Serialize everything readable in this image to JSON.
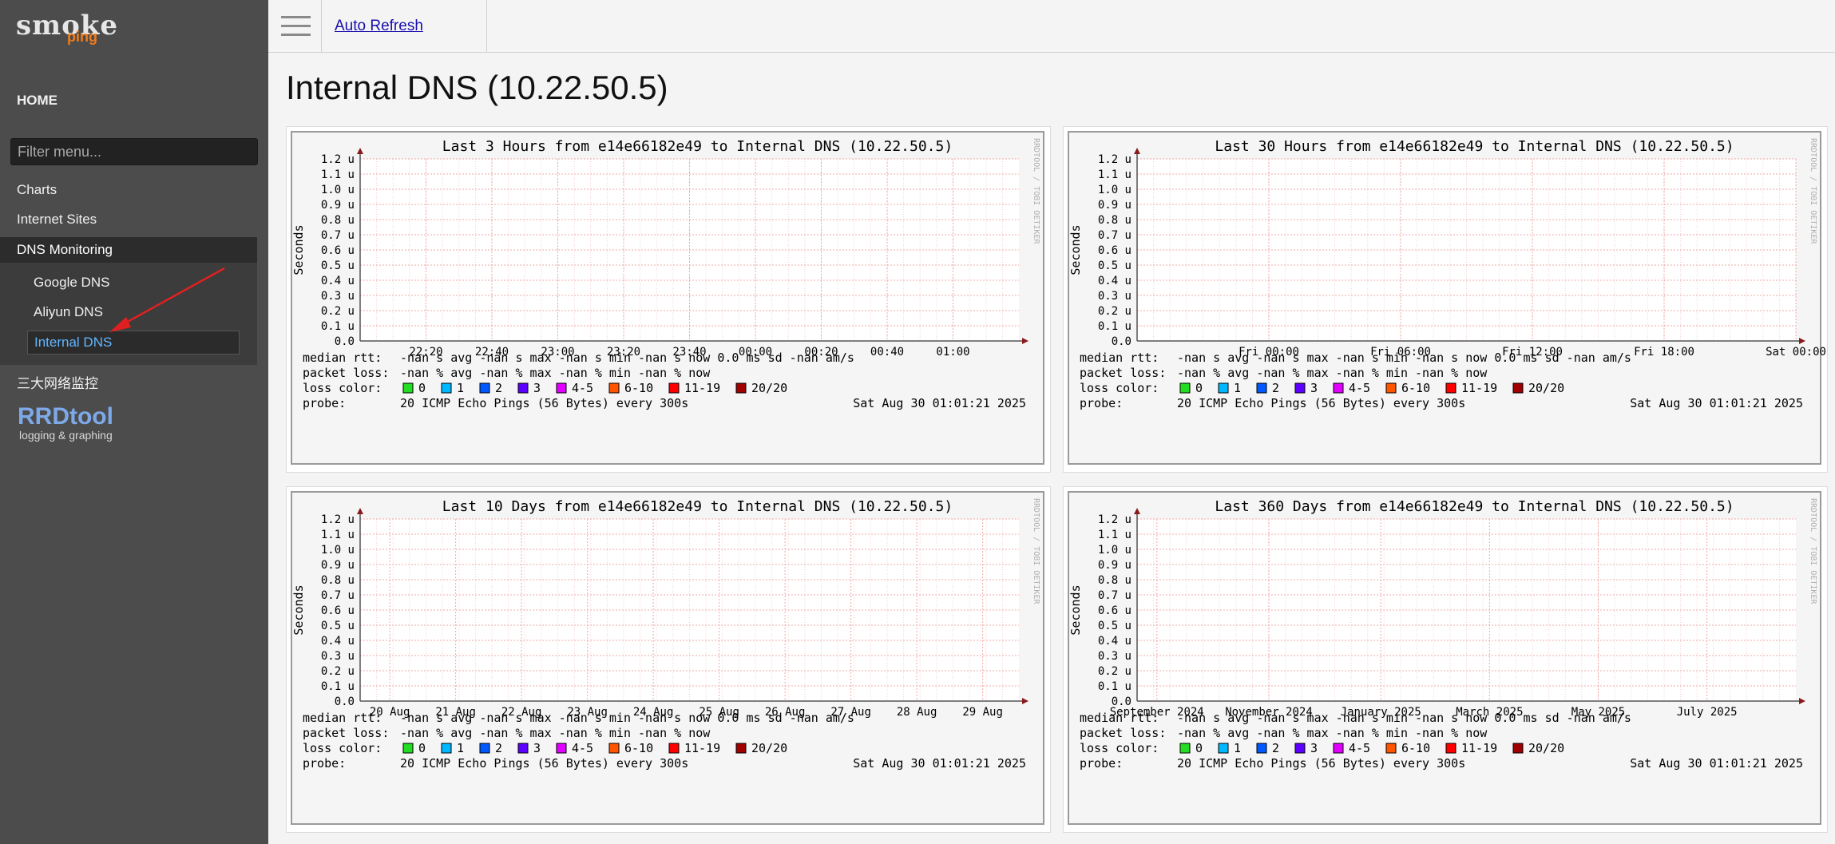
{
  "sidebar": {
    "logo_word": "smoke",
    "logo_sub": "ping",
    "home": "HOME",
    "filter_placeholder": "Filter menu...",
    "items": [
      "Charts",
      "Internet Sites"
    ],
    "dns_group": {
      "label": "DNS Monitoring",
      "children": [
        "Google DNS",
        "Aliyun DNS",
        "Internal DNS"
      ],
      "active": "Internal DNS"
    },
    "after_items": [
      "三大网络监控"
    ],
    "rrd_logo": "RRDtool",
    "rrd_tagline": "logging & graphing"
  },
  "topbar": {
    "auto_refresh": "Auto Refresh"
  },
  "main": {
    "title": "Internal DNS (10.22.50.5)"
  },
  "colors": {
    "sidebar_bg": "#4c4c4c",
    "active_link": "#62b6ff",
    "grid_minor": "#f7c7c7",
    "grid_major": "#e88",
    "annotation_arrow": "#e02020"
  },
  "chart_common": {
    "ylabel": "Seconds",
    "y_ticks": [
      "1.2 u",
      "1.1 u",
      "1.0 u",
      "0.9 u",
      "0.8 u",
      "0.7 u",
      "0.6 u",
      "0.5 u",
      "0.4 u",
      "0.3 u",
      "0.2 u",
      "0.1 u",
      "0.0"
    ],
    "watermark": "RRDTOOL / TOBI OETIKER",
    "median_rtt_label": "median rtt:",
    "median_rtt_value": "-nan  s avg   -nan  s max   -nan  s min   -nan  s now  0.0 ms sd   -nan   am/s",
    "packet_loss_label": "packet loss:",
    "packet_loss_value": "-nan % avg   -nan % max   -nan % min   -nan % now",
    "loss_color_label": "loss color:",
    "loss_colors": [
      {
        "label": "0",
        "color": "#22dd22"
      },
      {
        "label": "1",
        "color": "#00b8ff"
      },
      {
        "label": "2",
        "color": "#0059ff"
      },
      {
        "label": "3",
        "color": "#5e00ff"
      },
      {
        "label": "4-5",
        "color": "#e100ff"
      },
      {
        "label": "6-10",
        "color": "#ff5500"
      },
      {
        "label": "11-19",
        "color": "#ff0000"
      },
      {
        "label": "20/20",
        "color": "#a10000"
      }
    ],
    "probe_label": "probe:",
    "probe_value": "20 ICMP Echo Pings (56 Bytes) every 300s",
    "timestamp": "Sat Aug 30 01:01:21 2025"
  },
  "chart_data": [
    {
      "type": "line",
      "title": "Last 3 Hours from e14e66182e49 to Internal DNS (10.22.50.5)",
      "ylabel": "Seconds",
      "ylim": [
        0,
        1.2
      ],
      "y_unit": "u",
      "x_ticks": [
        "22:20",
        "22:40",
        "23:00",
        "23:20",
        "23:40",
        "00:00",
        "00:20",
        "00:40",
        "01:00"
      ],
      "x_tick_pos": [
        0.1,
        0.2,
        0.3,
        0.4,
        0.5,
        0.6,
        0.7,
        0.8,
        0.9
      ],
      "series": []
    },
    {
      "type": "line",
      "title": "Last 30 Hours from e14e66182e49 to Internal DNS (10.22.50.5)",
      "ylabel": "Seconds",
      "ylim": [
        0,
        1.2
      ],
      "y_unit": "u",
      "x_ticks": [
        "Fri 00:00",
        "Fri 06:00",
        "Fri 12:00",
        "Fri 18:00",
        "Sat 00:00"
      ],
      "x_tick_pos": [
        0.2,
        0.4,
        0.6,
        0.8,
        1.0
      ],
      "series": []
    },
    {
      "type": "line",
      "title": "Last 10 Days from e14e66182e49 to Internal DNS (10.22.50.5)",
      "ylabel": "Seconds",
      "ylim": [
        0,
        1.2
      ],
      "y_unit": "u",
      "x_ticks": [
        "20 Aug",
        "21 Aug",
        "22 Aug",
        "23 Aug",
        "24 Aug",
        "25 Aug",
        "26 Aug",
        "27 Aug",
        "28 Aug",
        "29 Aug"
      ],
      "x_tick_pos": [
        0.045,
        0.145,
        0.245,
        0.345,
        0.445,
        0.545,
        0.645,
        0.745,
        0.845,
        0.945
      ],
      "series": []
    },
    {
      "type": "line",
      "title": "Last 360 Days from e14e66182e49 to Internal DNS (10.22.50.5)",
      "ylabel": "Seconds",
      "ylim": [
        0,
        1.2
      ],
      "y_unit": "u",
      "x_ticks": [
        "September 2024",
        "November 2024",
        "January 2025",
        "March 2025",
        "May 2025",
        "July 2025"
      ],
      "x_tick_pos": [
        0.03,
        0.2,
        0.37,
        0.535,
        0.7,
        0.865
      ],
      "series": []
    }
  ]
}
